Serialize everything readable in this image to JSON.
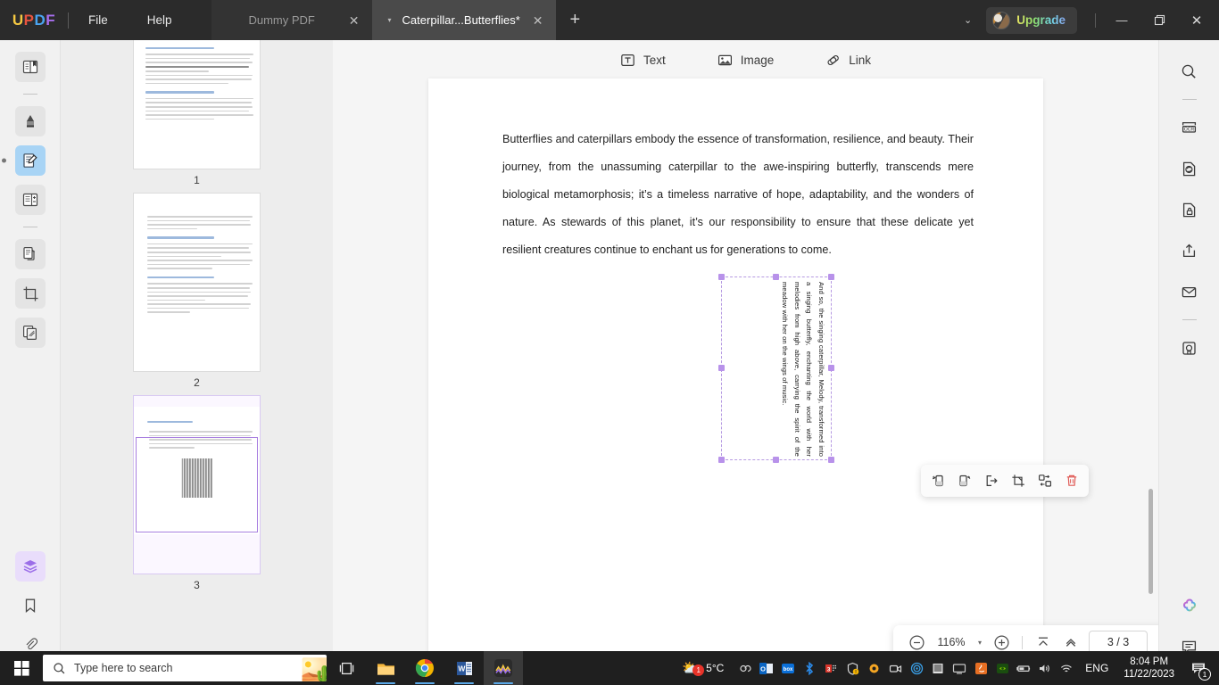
{
  "titlebar": {
    "logo": [
      "U",
      "P",
      "D",
      "F"
    ],
    "menus": [
      {
        "label": "File",
        "name": "menu-file"
      },
      {
        "label": "Help",
        "name": "menu-help"
      }
    ],
    "tabs": [
      {
        "label": "Dummy PDF",
        "active": false
      },
      {
        "label": "Caterpillar...Butterflies*",
        "active": true
      }
    ],
    "add_tab": "+",
    "upgrade_label": "Upgrade",
    "minimize": "—",
    "restore": "❐",
    "close": "✕",
    "chevron": "⌄"
  },
  "left_rail": {
    "items": [
      {
        "name": "sidebar-item-reader",
        "icon": "reader-icon",
        "state": "normal"
      },
      {
        "name": "sidebar-item-annotate",
        "icon": "highlighter-icon",
        "state": "normal"
      },
      {
        "name": "sidebar-item-edit-pdf",
        "icon": "edit-document-icon",
        "state": "active-blue"
      },
      {
        "name": "sidebar-item-form",
        "icon": "form-icon",
        "state": "normal"
      },
      {
        "name": "sidebar-item-page",
        "icon": "page-copy-icon",
        "state": "normal"
      },
      {
        "name": "sidebar-item-crop",
        "icon": "crop-page-icon",
        "state": "normal"
      },
      {
        "name": "sidebar-item-organize",
        "icon": "organize-pages-icon",
        "state": "normal"
      }
    ],
    "bottom_items": [
      {
        "name": "sidebar-item-layers",
        "icon": "layers-icon",
        "state": "active-purple"
      },
      {
        "name": "sidebar-item-bookmark",
        "icon": "bookmark-icon",
        "state": "plain"
      },
      {
        "name": "sidebar-item-attachment",
        "icon": "paperclip-icon",
        "state": "plain"
      }
    ]
  },
  "thumbnails": {
    "pages": [
      {
        "number": "1",
        "selected": false
      },
      {
        "number": "2",
        "selected": false
      },
      {
        "number": "3",
        "selected": true
      }
    ]
  },
  "edit_toolbar": {
    "items": [
      {
        "label": "Text",
        "icon": "text-box-icon",
        "name": "tool-text"
      },
      {
        "label": "Image",
        "icon": "image-icon",
        "name": "tool-image"
      },
      {
        "label": "Link",
        "icon": "link-icon",
        "name": "tool-link"
      }
    ]
  },
  "document": {
    "paragraph": "Butterflies and caterpillars embody the essence of transformation, resilience, and beauty. Their journey, from the unassuming caterpillar to the awe-inspiring butterfly, transcends mere biological metamorphosis; it’s a timeless narrative of hope, adaptability, and the wonders of nature. As stewards of this planet, it’s our responsibility to ensure that these delicate yet resilient creatures continue to enchant us for generations to come.",
    "rotated_textbox": "And so, the singing caterpillar, Melody, transformed into a singing butterfly, enchanting the world with her melodies from high above, carrying the spirit of the meadow with her on the wings of music."
  },
  "float_toolbar": {
    "buttons": [
      {
        "name": "rotate-left-button",
        "icon": "rotate-left-icon"
      },
      {
        "name": "rotate-right-button",
        "icon": "rotate-right-icon"
      },
      {
        "name": "extract-button",
        "icon": "extract-icon"
      },
      {
        "name": "crop-button",
        "icon": "crop-icon"
      },
      {
        "name": "replace-button",
        "icon": "replace-icon"
      },
      {
        "name": "delete-button",
        "icon": "trash-icon"
      }
    ]
  },
  "zoombar": {
    "zoom_out": "−",
    "zoom_level": "116%",
    "zoom_dropdown": "▾",
    "zoom_in": "+",
    "page_indicator": "3 / 3",
    "close": "✕",
    "buttons": [
      {
        "name": "first-page-button",
        "icon": "first-page-icon",
        "disabled": false
      },
      {
        "name": "previous-page-button",
        "icon": "chevron-up-icon",
        "disabled": false
      },
      {
        "name": "next-page-button",
        "icon": "chevron-down-icon",
        "disabled": true
      },
      {
        "name": "last-page-button",
        "icon": "last-page-icon",
        "disabled": true
      }
    ]
  },
  "right_rail": {
    "items": [
      {
        "name": "search-button",
        "icon": "search-icon"
      },
      {
        "name": "ocr-button",
        "icon": "ocr-icon"
      },
      {
        "name": "convert-button",
        "icon": "convert-icon"
      },
      {
        "name": "protect-button",
        "icon": "lock-document-icon"
      },
      {
        "name": "share-button",
        "icon": "share-icon"
      },
      {
        "name": "mail-button",
        "icon": "mail-icon"
      },
      {
        "name": "save-button",
        "icon": "save-icon"
      }
    ],
    "bottom_items": [
      {
        "name": "ai-assistant-button",
        "icon": "ai-flower-icon"
      },
      {
        "name": "comment-button",
        "icon": "comment-icon"
      }
    ]
  },
  "taskbar": {
    "search_placeholder": "Type here to search",
    "apps": [
      {
        "name": "taskview-button",
        "icon": "task-view-icon"
      },
      {
        "name": "file-explorer-button",
        "icon": "folder-icon"
      },
      {
        "name": "chrome-button",
        "icon": "chrome-icon"
      },
      {
        "name": "word-button",
        "icon": "word-icon"
      },
      {
        "name": "updf-button",
        "icon": "updf-app-icon"
      }
    ],
    "weather": "5°C",
    "weather_badge": "1",
    "language": "ENG",
    "time": "8:04 PM",
    "date": "11/22/2023",
    "notification_count": "1"
  },
  "colors": {
    "titlebar_bg": "#2b2b2b",
    "accent_purple": "#b892ea",
    "active_blue": "#a8d4f5",
    "delete_red": "#e05a55",
    "page_bg": "#ffffff"
  }
}
